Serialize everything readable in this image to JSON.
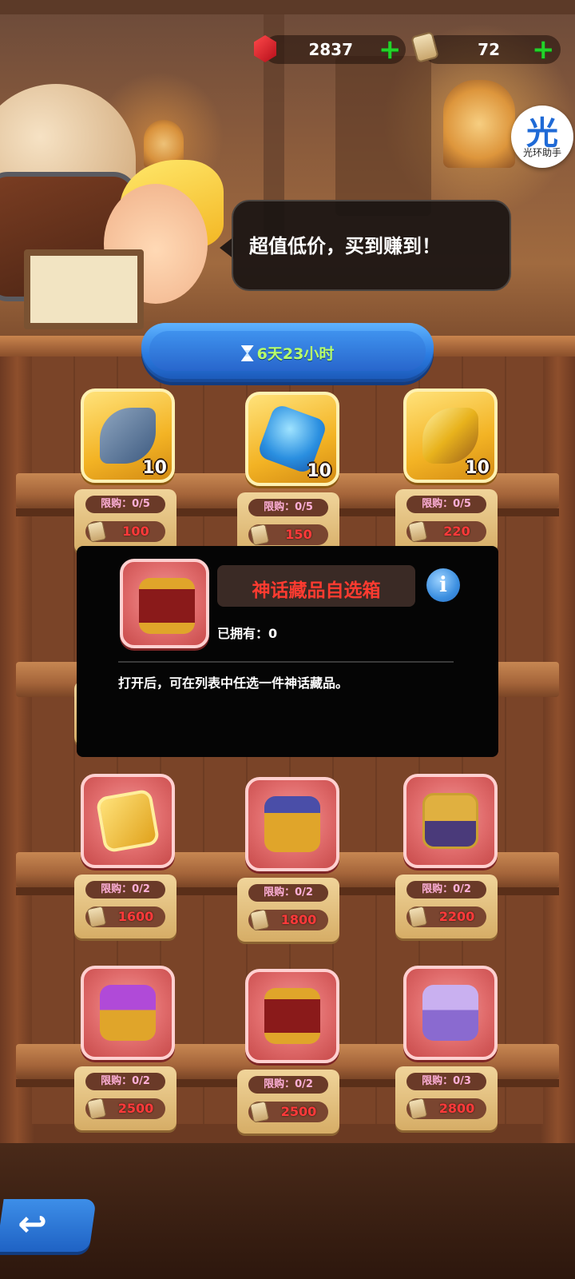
{
  "currency": {
    "gems": {
      "icon": "red-gem-icon",
      "value": "2837",
      "add_icon": "plus-icon"
    },
    "scrolls": {
      "icon": "scroll-icon",
      "value": "72",
      "add_icon": "plus-icon"
    }
  },
  "helper": {
    "glyph": "光",
    "label": "光环助手"
  },
  "speech": {
    "text": "超值低价，买到赚到！"
  },
  "timer": {
    "icon": "hourglass-icon",
    "text": "6天23小时"
  },
  "shelves": [
    {
      "items": [
        {
          "icon": "horn-pipe-icon",
          "tile": "gold",
          "qty": "10",
          "limit": "限购：0/5",
          "price": "100"
        },
        {
          "icon": "blue-crystal-icon",
          "tile": "gold",
          "qty": "10",
          "limit": "限购：0/5",
          "price": "150"
        },
        {
          "icon": "gold-horn-icon",
          "tile": "gold",
          "qty": "10",
          "limit": "限购：0/5",
          "price": "220"
        }
      ]
    },
    {
      "items": [
        {
          "icon": "golden-frame-icon",
          "tile": "red",
          "qty": "",
          "limit": "限购：0/2",
          "price": "1600"
        },
        {
          "icon": "shield-chest-icon",
          "tile": "red",
          "qty": "",
          "limit": "限购：0/2",
          "price": "1800"
        },
        {
          "icon": "eye-card-icon",
          "tile": "red",
          "qty": "",
          "limit": "限购：0/2",
          "price": "2200"
        }
      ]
    },
    {
      "items": [
        {
          "icon": "purple-chest-icon",
          "tile": "red",
          "qty": "",
          "limit": "限购：0/2",
          "price": "2500"
        },
        {
          "icon": "red-gold-chest-icon",
          "tile": "red",
          "qty": "",
          "limit": "限购：0/2",
          "price": "2500"
        },
        {
          "icon": "lavender-chest-icon",
          "tile": "red",
          "qty": "",
          "limit": "限购：0/3",
          "price": "2800"
        }
      ]
    }
  ],
  "popup": {
    "icon": "red-gold-chest-icon",
    "name": "神话藏品自选箱",
    "info_glyph": "i",
    "owned": "已拥有：0",
    "description": "打开后，可在列表中任选一件神话藏品。"
  },
  "back": {
    "icon": "back-arrow-icon",
    "glyph": "↩"
  },
  "colors": {
    "price_red": "#ff3a3a",
    "timer_green": "#b8ff6a",
    "accent_blue": "#2b7be0"
  }
}
